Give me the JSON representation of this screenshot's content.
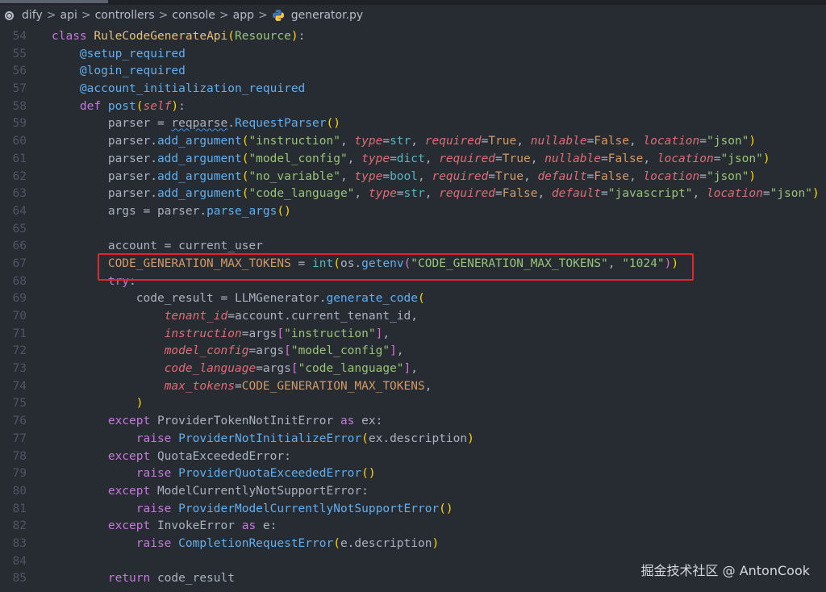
{
  "breadcrumb": {
    "items": [
      "dify",
      "api",
      "controllers",
      "console",
      "app"
    ],
    "file": "generator.py",
    "separator": ">"
  },
  "highlight_color": "#e0262a",
  "watermark": "掘金技术社区 @ AntonCook",
  "code": [
    {
      "n": "54",
      "t": [
        [
          "k",
          "class "
        ],
        [
          "c",
          "RuleCodeGenerateApi"
        ],
        [
          "y",
          "("
        ],
        [
          "g",
          "Resource"
        ],
        [
          "y",
          ")"
        ],
        [
          "",
          ""
        ],
        [
          "",
          ":"
        ]
      ]
    },
    {
      "n": "55",
      "t": [
        [
          "",
          "    "
        ],
        [
          "d",
          "@setup_required"
        ]
      ]
    },
    {
      "n": "56",
      "t": [
        [
          "",
          "    "
        ],
        [
          "d",
          "@login_required"
        ]
      ]
    },
    {
      "n": "57",
      "t": [
        [
          "",
          "    "
        ],
        [
          "d",
          "@account_initialization_required"
        ]
      ]
    },
    {
      "n": "58",
      "t": [
        [
          "",
          "    "
        ],
        [
          "k",
          "def "
        ],
        [
          "f",
          "post"
        ],
        [
          "y",
          "("
        ],
        [
          "p",
          "self"
        ],
        [
          "y",
          ")"
        ],
        [
          "",
          ":"
        ]
      ]
    },
    {
      "n": "59",
      "t": [
        [
          "",
          "        parser = "
        ],
        [
          "w",
          "reqparse"
        ],
        [
          "",
          "."
        ],
        [
          "f",
          "RequestParser"
        ],
        [
          "y",
          "()"
        ]
      ]
    },
    {
      "n": "60",
      "t": [
        [
          "",
          "        parser."
        ],
        [
          "f",
          "add_argument"
        ],
        [
          "y",
          "("
        ],
        [
          "s",
          "\"instruction\""
        ],
        [
          "",
          ", "
        ],
        [
          "p",
          "type"
        ],
        [
          "",
          "="
        ],
        [
          "b",
          "str"
        ],
        [
          "",
          ", "
        ],
        [
          "p",
          "required"
        ],
        [
          "",
          "="
        ],
        [
          "n",
          "True"
        ],
        [
          "",
          ", "
        ],
        [
          "p",
          "nullable"
        ],
        [
          "",
          "="
        ],
        [
          "n",
          "False"
        ],
        [
          "",
          ", "
        ],
        [
          "p",
          "location"
        ],
        [
          "",
          "="
        ],
        [
          "s",
          "\"json\""
        ],
        [
          "y",
          ")"
        ]
      ]
    },
    {
      "n": "61",
      "t": [
        [
          "",
          "        parser."
        ],
        [
          "f",
          "add_argument"
        ],
        [
          "y",
          "("
        ],
        [
          "s",
          "\"model_config\""
        ],
        [
          "",
          ", "
        ],
        [
          "p",
          "type"
        ],
        [
          "",
          "="
        ],
        [
          "b",
          "dict"
        ],
        [
          "",
          ", "
        ],
        [
          "p",
          "required"
        ],
        [
          "",
          "="
        ],
        [
          "n",
          "True"
        ],
        [
          "",
          ", "
        ],
        [
          "p",
          "nullable"
        ],
        [
          "",
          "="
        ],
        [
          "n",
          "False"
        ],
        [
          "",
          ", "
        ],
        [
          "p",
          "location"
        ],
        [
          "",
          "="
        ],
        [
          "s",
          "\"json\""
        ],
        [
          "y",
          ")"
        ]
      ]
    },
    {
      "n": "62",
      "t": [
        [
          "",
          "        parser."
        ],
        [
          "f",
          "add_argument"
        ],
        [
          "y",
          "("
        ],
        [
          "s",
          "\"no_variable\""
        ],
        [
          "",
          ", "
        ],
        [
          "p",
          "type"
        ],
        [
          "",
          "="
        ],
        [
          "b",
          "bool"
        ],
        [
          "",
          ", "
        ],
        [
          "p",
          "required"
        ],
        [
          "",
          "="
        ],
        [
          "n",
          "True"
        ],
        [
          "",
          ", "
        ],
        [
          "p",
          "default"
        ],
        [
          "",
          "="
        ],
        [
          "n",
          "False"
        ],
        [
          "",
          ", "
        ],
        [
          "p",
          "location"
        ],
        [
          "",
          "="
        ],
        [
          "s",
          "\"json\""
        ],
        [
          "y",
          ")"
        ]
      ]
    },
    {
      "n": "63",
      "t": [
        [
          "",
          "        parser."
        ],
        [
          "f",
          "add_argument"
        ],
        [
          "y",
          "("
        ],
        [
          "s",
          "\"code_language\""
        ],
        [
          "",
          ", "
        ],
        [
          "p",
          "type"
        ],
        [
          "",
          "="
        ],
        [
          "b",
          "str"
        ],
        [
          "",
          ", "
        ],
        [
          "p",
          "required"
        ],
        [
          "",
          "="
        ],
        [
          "n",
          "False"
        ],
        [
          "",
          ", "
        ],
        [
          "p",
          "default"
        ],
        [
          "",
          "="
        ],
        [
          "s",
          "\"javascript\""
        ],
        [
          "",
          ", "
        ],
        [
          "p",
          "location"
        ],
        [
          "",
          "="
        ],
        [
          "s",
          "\"json\""
        ],
        [
          "y",
          ")"
        ]
      ]
    },
    {
      "n": "64",
      "t": [
        [
          "",
          "        args = parser."
        ],
        [
          "f",
          "parse_args"
        ],
        [
          "y",
          "()"
        ]
      ]
    },
    {
      "n": "65",
      "t": []
    },
    {
      "n": "66",
      "t": [
        [
          "",
          "        account = current_user"
        ]
      ]
    },
    {
      "n": "67",
      "t": [
        [
          "",
          "        "
        ],
        [
          "n",
          "CODE_GENERATION_MAX_TOKENS"
        ],
        [
          "",
          " = "
        ],
        [
          "b",
          "int"
        ],
        [
          "y",
          "("
        ],
        [
          "",
          "os."
        ],
        [
          "f",
          "getenv"
        ],
        [
          "m",
          "("
        ],
        [
          "s",
          "\"CODE_GENERATION_MAX_TOKENS\""
        ],
        [
          "",
          ", "
        ],
        [
          "s",
          "\"1024\""
        ],
        [
          "m",
          ")"
        ],
        [
          "y",
          ")"
        ]
      ]
    },
    {
      "n": "68",
      "t": [
        [
          "",
          "        "
        ],
        [
          "k",
          "try"
        ],
        [
          "",
          ":"
        ]
      ]
    },
    {
      "n": "69",
      "t": [
        [
          "",
          "            code_result = LLMGenerator."
        ],
        [
          "f",
          "generate_code"
        ],
        [
          "y",
          "("
        ]
      ]
    },
    {
      "n": "70",
      "t": [
        [
          "",
          "                "
        ],
        [
          "p",
          "tenant_id"
        ],
        [
          "",
          "=account.current_tenant_id,"
        ]
      ]
    },
    {
      "n": "71",
      "t": [
        [
          "",
          "                "
        ],
        [
          "p",
          "instruction"
        ],
        [
          "",
          "=args"
        ],
        [
          "m",
          "["
        ],
        [
          "s",
          "\"instruction\""
        ],
        [
          "m",
          "]"
        ],
        [
          "",
          ","
        ]
      ]
    },
    {
      "n": "72",
      "t": [
        [
          "",
          "                "
        ],
        [
          "p",
          "model_config"
        ],
        [
          "",
          "=args"
        ],
        [
          "m",
          "["
        ],
        [
          "s",
          "\"model_config\""
        ],
        [
          "m",
          "]"
        ],
        [
          "",
          ","
        ]
      ]
    },
    {
      "n": "73",
      "t": [
        [
          "",
          "                "
        ],
        [
          "p",
          "code_language"
        ],
        [
          "",
          "=args"
        ],
        [
          "m",
          "["
        ],
        [
          "s",
          "\"code_language\""
        ],
        [
          "m",
          "]"
        ],
        [
          "",
          ","
        ]
      ]
    },
    {
      "n": "74",
      "t": [
        [
          "",
          "                "
        ],
        [
          "p",
          "max_tokens"
        ],
        [
          "",
          "="
        ],
        [
          "n",
          "CODE_GENERATION_MAX_TOKENS"
        ],
        [
          "",
          ","
        ]
      ]
    },
    {
      "n": "75",
      "t": [
        [
          "",
          "            "
        ],
        [
          "y",
          ")"
        ]
      ]
    },
    {
      "n": "76",
      "t": [
        [
          "",
          "        "
        ],
        [
          "k",
          "except "
        ],
        [
          "",
          "ProviderTokenNotInitError "
        ],
        [
          "k",
          "as"
        ],
        [
          "",
          " ex:"
        ]
      ]
    },
    {
      "n": "77",
      "t": [
        [
          "",
          "            "
        ],
        [
          "k",
          "raise "
        ],
        [
          "f",
          "ProviderNotInitializeError"
        ],
        [
          "y",
          "("
        ],
        [
          "",
          "ex.description"
        ],
        [
          "y",
          ")"
        ]
      ]
    },
    {
      "n": "78",
      "t": [
        [
          "",
          "        "
        ],
        [
          "k",
          "except "
        ],
        [
          "",
          "QuotaExceededError:"
        ]
      ]
    },
    {
      "n": "79",
      "t": [
        [
          "",
          "            "
        ],
        [
          "k",
          "raise "
        ],
        [
          "f",
          "ProviderQuotaExceededError"
        ],
        [
          "y",
          "()"
        ]
      ]
    },
    {
      "n": "80",
      "t": [
        [
          "",
          "        "
        ],
        [
          "k",
          "except "
        ],
        [
          "",
          "ModelCurrentlyNotSupportError:"
        ]
      ]
    },
    {
      "n": "81",
      "t": [
        [
          "",
          "            "
        ],
        [
          "k",
          "raise "
        ],
        [
          "f",
          "ProviderModelCurrentlyNotSupportError"
        ],
        [
          "y",
          "()"
        ]
      ]
    },
    {
      "n": "82",
      "t": [
        [
          "",
          "        "
        ],
        [
          "k",
          "except "
        ],
        [
          "",
          "InvokeError "
        ],
        [
          "k",
          "as"
        ],
        [
          "",
          " e:"
        ]
      ]
    },
    {
      "n": "83",
      "t": [
        [
          "",
          "            "
        ],
        [
          "k",
          "raise "
        ],
        [
          "f",
          "CompletionRequestError"
        ],
        [
          "y",
          "("
        ],
        [
          "",
          "e.description"
        ],
        [
          "y",
          ")"
        ]
      ]
    },
    {
      "n": "84",
      "t": []
    },
    {
      "n": "85",
      "t": [
        [
          "",
          "        "
        ],
        [
          "k",
          "return "
        ],
        [
          "",
          "code_result"
        ]
      ]
    }
  ]
}
